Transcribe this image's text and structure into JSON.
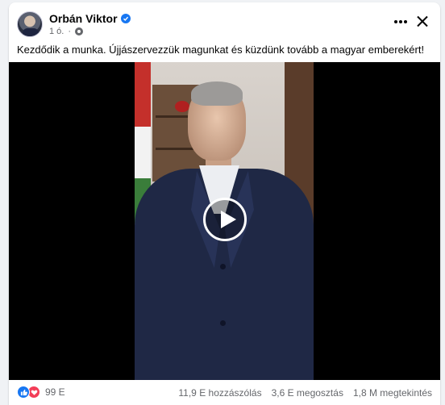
{
  "post": {
    "author": "Orbán Viktor",
    "time": "1 ó.",
    "caption": "Kezdődik a munka. Újjászervezzük magunkat és küzdünk tovább a magyar emberekért!"
  },
  "icons": {
    "verified": "verified-badge-icon",
    "audience": "globe-icon",
    "more": "more-icon",
    "close": "close-icon",
    "play": "play-icon",
    "like": "like-reaction-icon",
    "love": "love-reaction-icon"
  },
  "colors": {
    "accent": "#1877f2",
    "love": "#f33e58",
    "muted": "#65676b"
  },
  "footer": {
    "reaction_count": "99 E",
    "comments": "11,9 E hozzászólás",
    "shares": "3,6 E megosztás",
    "views": "1,8 M megtekintés"
  }
}
